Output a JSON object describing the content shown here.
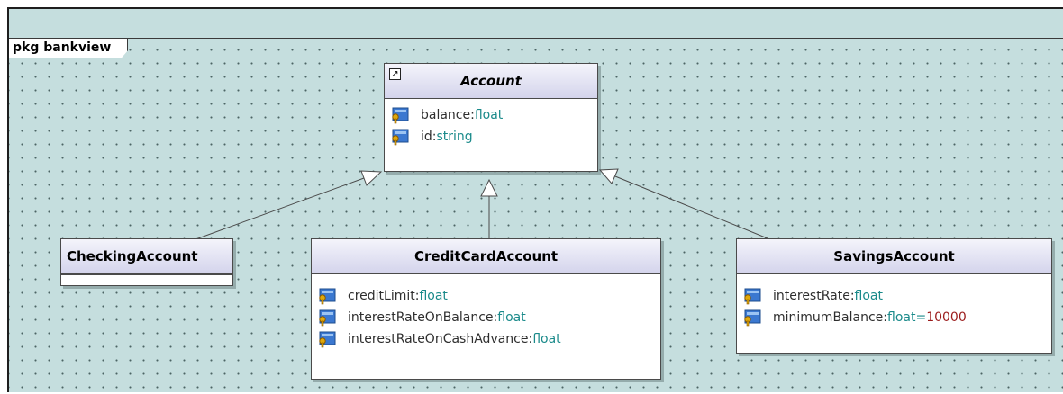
{
  "package": {
    "label": "pkg bankview"
  },
  "classes": {
    "account": {
      "name": "Account",
      "attributes": [
        {
          "name": "balance",
          "type": "float"
        },
        {
          "name": "id",
          "type": "string"
        }
      ]
    },
    "checking": {
      "name": "CheckingAccount"
    },
    "creditcard": {
      "name": "CreditCardAccount",
      "attributes": [
        {
          "name": "creditLimit",
          "type": "float"
        },
        {
          "name": "interestRateOnBalance",
          "type": "float"
        },
        {
          "name": "interestRateOnCashAdvance",
          "type": "float"
        }
      ]
    },
    "savings": {
      "name": "SavingsAccount",
      "attributes": [
        {
          "name": "interestRate",
          "type": "float"
        },
        {
          "name": "minimumBalance",
          "type": "float",
          "default": "10000"
        }
      ]
    }
  },
  "relationships": [
    {
      "kind": "generalization",
      "from": "CheckingAccount",
      "to": "Account"
    },
    {
      "kind": "generalization",
      "from": "CreditCardAccount",
      "to": "Account"
    },
    {
      "kind": "generalization",
      "from": "SavingsAccount",
      "to": "Account"
    }
  ],
  "icons": {
    "attribute": "attribute-key-icon",
    "shortcut": "shortcut-link-icon"
  },
  "colors": {
    "canvas": "#c5dede",
    "class_header": "#d4d4ec",
    "type_text": "#1a8a8a",
    "default_value": "#9b1c1c"
  }
}
